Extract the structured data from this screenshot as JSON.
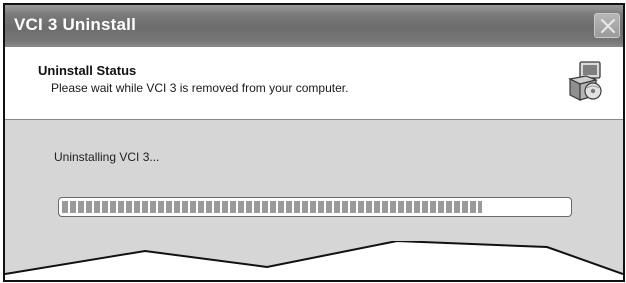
{
  "window": {
    "title": "VCI 3 Uninstall",
    "close_icon": "close-x-icon"
  },
  "header": {
    "title": "Uninstall Status",
    "subtitle": "Please wait while VCI 3 is removed from your computer.",
    "icon": "installer-computer-disc-icon"
  },
  "body": {
    "status_text": "Uninstalling VCI 3..."
  },
  "progress": {
    "percent": 83
  }
}
